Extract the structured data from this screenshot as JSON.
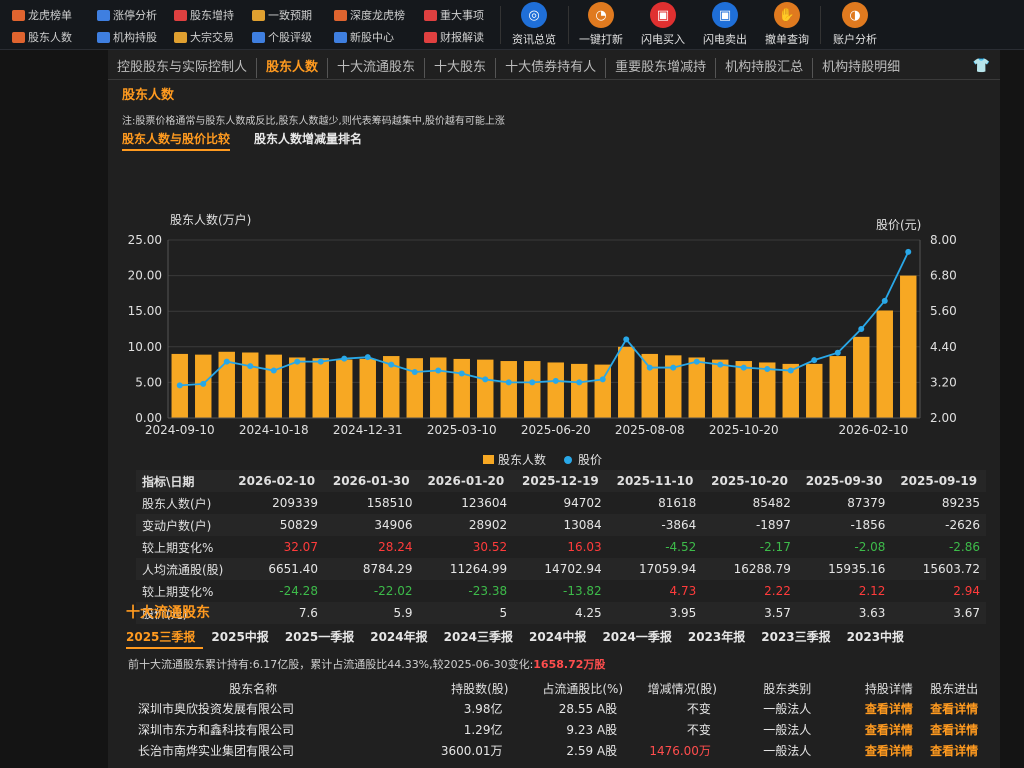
{
  "toolbar": {
    "small_items": [
      {
        "label": "龙虎榜单",
        "icon": "list-icon",
        "color": "#e0642f"
      },
      {
        "label": "股东人数",
        "icon": "people-icon",
        "color": "#e0642f"
      },
      {
        "label": "涨停分析",
        "icon": "chart-icon",
        "color": "#3f7fe0"
      },
      {
        "label": "机构持股",
        "icon": "building-icon",
        "color": "#3f7fe0"
      },
      {
        "label": "股东增持",
        "icon": "chart-up-icon",
        "color": "#e04040"
      },
      {
        "label": "大宗交易",
        "icon": "clock-icon",
        "color": "#e0a030"
      },
      {
        "label": "一致预期",
        "icon": "check-icon",
        "color": "#e0a030"
      },
      {
        "label": "个股评级",
        "icon": "star-icon",
        "color": "#3f7fe0"
      },
      {
        "label": "深度龙虎榜",
        "icon": "dragon-icon",
        "color": "#e0642f"
      },
      {
        "label": "新股中心",
        "icon": "new-icon",
        "color": "#3f7fe0"
      },
      {
        "label": "重大事项",
        "icon": "flag-icon",
        "color": "#e04040"
      },
      {
        "label": "财报解读",
        "icon": "report-icon",
        "color": "#e04040"
      }
    ],
    "big_items": [
      {
        "label": "资讯总览",
        "icon": "globe-icon",
        "color": "#1f6fd8"
      },
      {
        "label": "一键打新",
        "icon": "gauge-icon",
        "color": "#e07a1f"
      },
      {
        "label": "闪电买入",
        "icon": "buy-icon",
        "color": "#e03030"
      },
      {
        "label": "闪电卖出",
        "icon": "sell-icon",
        "color": "#1f6fd8"
      },
      {
        "label": "撤单查询",
        "icon": "hand-icon",
        "color": "#e07a1f"
      },
      {
        "label": "账户分析",
        "icon": "account-icon",
        "color": "#e07a1f"
      }
    ]
  },
  "tabs": [
    "控股股东与实际控制人",
    "股东人数",
    "十大流通股东",
    "十大股东",
    "十大债券持有人",
    "重要股东增减持",
    "机构持股汇总",
    "机构持股明细"
  ],
  "active_tab": 1,
  "section1": {
    "title": "股东人数",
    "note": "注:股票价格通常与股东人数成反比,股东人数越少,则代表筹码越集中,股价越有可能上涨",
    "subtabs": [
      "股东人数与股价比较",
      "股东人数增减量排名"
    ]
  },
  "chart_data": {
    "type": "bar",
    "title": "",
    "ylabel": "股东人数(万户)",
    "ylabel_right": "股价(元)",
    "ylim": [
      0,
      25
    ],
    "ylim_right": [
      2,
      8
    ],
    "yticks": [
      "0.00",
      "5.00",
      "10.00",
      "15.00",
      "20.00",
      "25.00"
    ],
    "yticks_right": [
      "2.00",
      "3.20",
      "4.40",
      "5.60",
      "6.80",
      "8.00"
    ],
    "xtick_labels": [
      "2024-09-10",
      "2024-10-18",
      "2024-12-31",
      "2025-03-10",
      "2025-06-20",
      "2025-08-08",
      "2025-10-20",
      "2026-02-10"
    ],
    "legend": [
      "股东人数",
      "股价"
    ],
    "legend_position": "bottom",
    "grid": true,
    "series": [
      {
        "name": "股东人数",
        "type": "bar",
        "color": "#f7a823",
        "values": [
          9.0,
          8.9,
          9.3,
          9.2,
          8.9,
          8.5,
          8.4,
          8.2,
          8.3,
          8.7,
          8.4,
          8.5,
          8.3,
          8.2,
          8.0,
          8.0,
          7.8,
          7.6,
          7.5,
          10.0,
          9.0,
          8.8,
          8.5,
          8.2,
          8.0,
          7.8,
          7.6,
          7.6,
          8.7,
          11.4,
          15.1,
          20.0
        ]
      },
      {
        "name": "股价",
        "type": "line",
        "color": "#29a8e8",
        "values": [
          3.1,
          3.15,
          3.9,
          3.75,
          3.6,
          3.9,
          3.9,
          4.0,
          4.05,
          3.8,
          3.55,
          3.6,
          3.5,
          3.3,
          3.2,
          3.2,
          3.25,
          3.2,
          3.3,
          4.65,
          3.7,
          3.7,
          3.9,
          3.8,
          3.7,
          3.65,
          3.6,
          3.95,
          4.2,
          5.0,
          5.95,
          7.6
        ]
      }
    ]
  },
  "stats_table": {
    "corner": "指标\\日期",
    "dates": [
      "2026-02-10",
      "2026-01-30",
      "2026-01-20",
      "2025-12-19",
      "2025-11-10",
      "2025-10-20",
      "2025-09-30",
      "2025-09-19"
    ],
    "rows": [
      {
        "label": "股东人数(户)",
        "values": [
          "209339",
          "158510",
          "123604",
          "94702",
          "81618",
          "85482",
          "87379",
          "89235"
        ],
        "colored": false
      },
      {
        "label": "变动户数(户)",
        "values": [
          "50829",
          "34906",
          "28902",
          "13084",
          "-3864",
          "-1897",
          "-1856",
          "-2626"
        ],
        "colored": false
      },
      {
        "label": "较上期变化%",
        "values": [
          "32.07",
          "28.24",
          "30.52",
          "16.03",
          "-4.52",
          "-2.17",
          "-2.08",
          "-2.86"
        ],
        "colored": true
      },
      {
        "label": "人均流通股(股)",
        "values": [
          "6651.40",
          "8784.29",
          "11264.99",
          "14702.94",
          "17059.94",
          "16288.79",
          "15935.16",
          "15603.72"
        ],
        "colored": false
      },
      {
        "label": "较上期变化%",
        "values": [
          "-24.28",
          "-22.02",
          "-23.38",
          "-13.82",
          "4.73",
          "2.22",
          "2.12",
          "2.94"
        ],
        "colored": true
      },
      {
        "label": "股价(元)",
        "values": [
          "7.6",
          "5.9",
          "5",
          "4.25",
          "3.95",
          "3.57",
          "3.63",
          "3.67"
        ],
        "colored": false
      }
    ]
  },
  "section2": {
    "title": "十大流通股东",
    "periods": [
      "2025三季报",
      "2025中报",
      "2025一季报",
      "2024年报",
      "2024三季报",
      "2024中报",
      "2024一季报",
      "2023年报",
      "2023三季报",
      "2023中报"
    ],
    "active_period": 0,
    "summary_prefix": "前十大流通股东累计持有:6.17亿股，累计占流通股比44.33%,较2025-06-30变化:",
    "summary_change": "1658.72万股",
    "headers": [
      "股东名称",
      "持股数(股)",
      "占流通股比(%)",
      "增减情况(股)",
      "股东类别",
      "持股详情",
      "股东进出"
    ],
    "rows": [
      {
        "name": "深圳市奥欣投资发展有限公司",
        "shares": "3.98亿",
        "ratio": "28.55 A股",
        "change": "不变",
        "type": "一般法人",
        "detail": "查看详情",
        "inout": "查看详情"
      },
      {
        "name": "深圳市东方和鑫科技有限公司",
        "shares": "1.29亿",
        "ratio": "9.23 A股",
        "change": "不变",
        "type": "一般法人",
        "detail": "查看详情",
        "inout": "查看详情"
      },
      {
        "name": "长治市南烨实业集团有限公司",
        "shares": "3600.01万",
        "ratio": "2.59 A股",
        "change": "1476.00万",
        "type": "一般法人",
        "detail": "查看详情",
        "inout": "查看详情"
      }
    ]
  }
}
